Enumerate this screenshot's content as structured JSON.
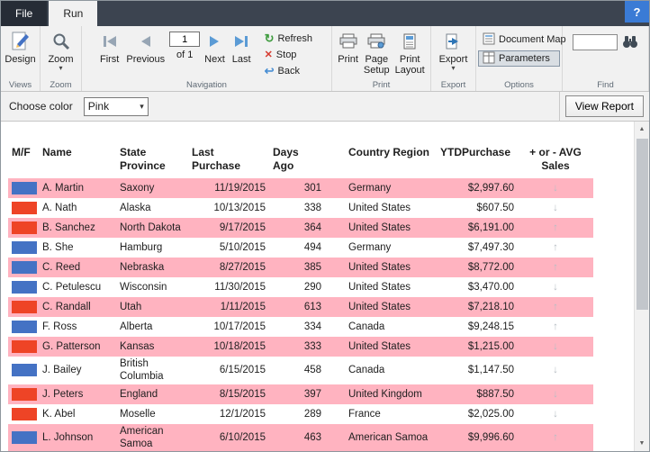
{
  "icons": {
    "chevron_down": "▾",
    "refresh": "↻",
    "stop": "✕",
    "back": "↩",
    "arrow_up": "↑",
    "arrow_down": "↓",
    "scroll_up": "▲",
    "scroll_down": "▼"
  },
  "window": {
    "help_label": "?"
  },
  "tabs": {
    "file": "File",
    "run": "Run"
  },
  "ribbon": {
    "views": {
      "design_label": "Design",
      "group_label": "Views"
    },
    "zoom": {
      "zoom_label": "Zoom",
      "group_label": "Zoom"
    },
    "navigation": {
      "first_label": "First",
      "previous_label": "Previous",
      "page_value": "1",
      "of_label": "of 1",
      "next_label": "Next",
      "last_label": "Last",
      "refresh_label": "Refresh",
      "stop_label": "Stop",
      "back_label": "Back",
      "group_label": "Navigation"
    },
    "print": {
      "print_label": "Print",
      "page_setup_label": "Page\nSetup",
      "print_layout_label": "Print\nLayout",
      "group_label": "Print"
    },
    "export": {
      "export_label": "Export",
      "group_label": "Export"
    },
    "options": {
      "document_map_label": "Document Map",
      "parameters_label": "Parameters",
      "group_label": "Options"
    },
    "find": {
      "input_value": "",
      "group_label": "Find"
    }
  },
  "parameter_bar": {
    "choose_color_label": "Choose color",
    "color_value": "Pink",
    "view_report_label": "View Report"
  },
  "report": {
    "colors": {
      "band_pink": "#FFB3C0",
      "swatch_blue": "#4472C4",
      "swatch_red": "#EE4426",
      "arrow_gray": "#B8BEC4"
    },
    "columns": [
      "M/F",
      "Name",
      "State\nProvince",
      "Last Purchase",
      "Days Ago",
      "Country Region",
      "YTDPurchase",
      "+ or - AVG\nSales"
    ],
    "rows": [
      {
        "mf": "blue",
        "band": "pink",
        "name": "A. Martin",
        "state": "Saxony",
        "last_purchase": "11/19/2015",
        "days_ago": "301",
        "country": "Germany",
        "ytd": "$2,997.60",
        "trend": "down"
      },
      {
        "mf": "red",
        "band": "white",
        "name": "A. Nath",
        "state": "Alaska",
        "last_purchase": "10/13/2015",
        "days_ago": "338",
        "country": "United States",
        "ytd": "$607.50",
        "trend": "down"
      },
      {
        "mf": "red",
        "band": "pink",
        "name": "B. Sanchez",
        "state": "North Dakota",
        "last_purchase": "9/17/2015",
        "days_ago": "364",
        "country": "United States",
        "ytd": "$6,191.00",
        "trend": "up"
      },
      {
        "mf": "blue",
        "band": "white",
        "name": "B. She",
        "state": "Hamburg",
        "last_purchase": "5/10/2015",
        "days_ago": "494",
        "country": "Germany",
        "ytd": "$7,497.30",
        "trend": "up"
      },
      {
        "mf": "blue",
        "band": "pink",
        "name": "C. Reed",
        "state": "Nebraska",
        "last_purchase": "8/27/2015",
        "days_ago": "385",
        "country": "United States",
        "ytd": "$8,772.00",
        "trend": "up"
      },
      {
        "mf": "blue",
        "band": "white",
        "name": "C. Petulescu",
        "state": "Wisconsin",
        "last_purchase": "11/30/2015",
        "days_ago": "290",
        "country": "United States",
        "ytd": "$3,470.00",
        "trend": "down"
      },
      {
        "mf": "red",
        "band": "pink",
        "name": "C. Randall",
        "state": "Utah",
        "last_purchase": "1/11/2015",
        "days_ago": "613",
        "country": "United States",
        "ytd": "$7,218.10",
        "trend": "up"
      },
      {
        "mf": "blue",
        "band": "white",
        "name": "F. Ross",
        "state": "Alberta",
        "last_purchase": "10/17/2015",
        "days_ago": "334",
        "country": "Canada",
        "ytd": "$9,248.15",
        "trend": "up"
      },
      {
        "mf": "red",
        "band": "pink",
        "name": "G. Patterson",
        "state": "Kansas",
        "last_purchase": "10/18/2015",
        "days_ago": "333",
        "country": "United States",
        "ytd": "$1,215.00",
        "trend": "down"
      },
      {
        "mf": "blue",
        "band": "white",
        "name": "J. Bailey",
        "state": "British Columbia",
        "last_purchase": "6/15/2015",
        "days_ago": "458",
        "country": "Canada",
        "ytd": "$1,147.50",
        "trend": "down"
      },
      {
        "mf": "red",
        "band": "pink",
        "name": "J. Peters",
        "state": "England",
        "last_purchase": "8/15/2015",
        "days_ago": "397",
        "country": "United Kingdom",
        "ytd": "$887.50",
        "trend": "down"
      },
      {
        "mf": "red",
        "band": "white",
        "name": "K. Abel",
        "state": "Moselle",
        "last_purchase": "12/1/2015",
        "days_ago": "289",
        "country": "France",
        "ytd": "$2,025.00",
        "trend": "down"
      },
      {
        "mf": "blue",
        "band": "pink",
        "name": "L. Johnson",
        "state": "American Samoa",
        "last_purchase": "6/10/2015",
        "days_ago": "463",
        "country": "American Samoa",
        "ytd": "$9,996.60",
        "trend": "up"
      }
    ]
  }
}
